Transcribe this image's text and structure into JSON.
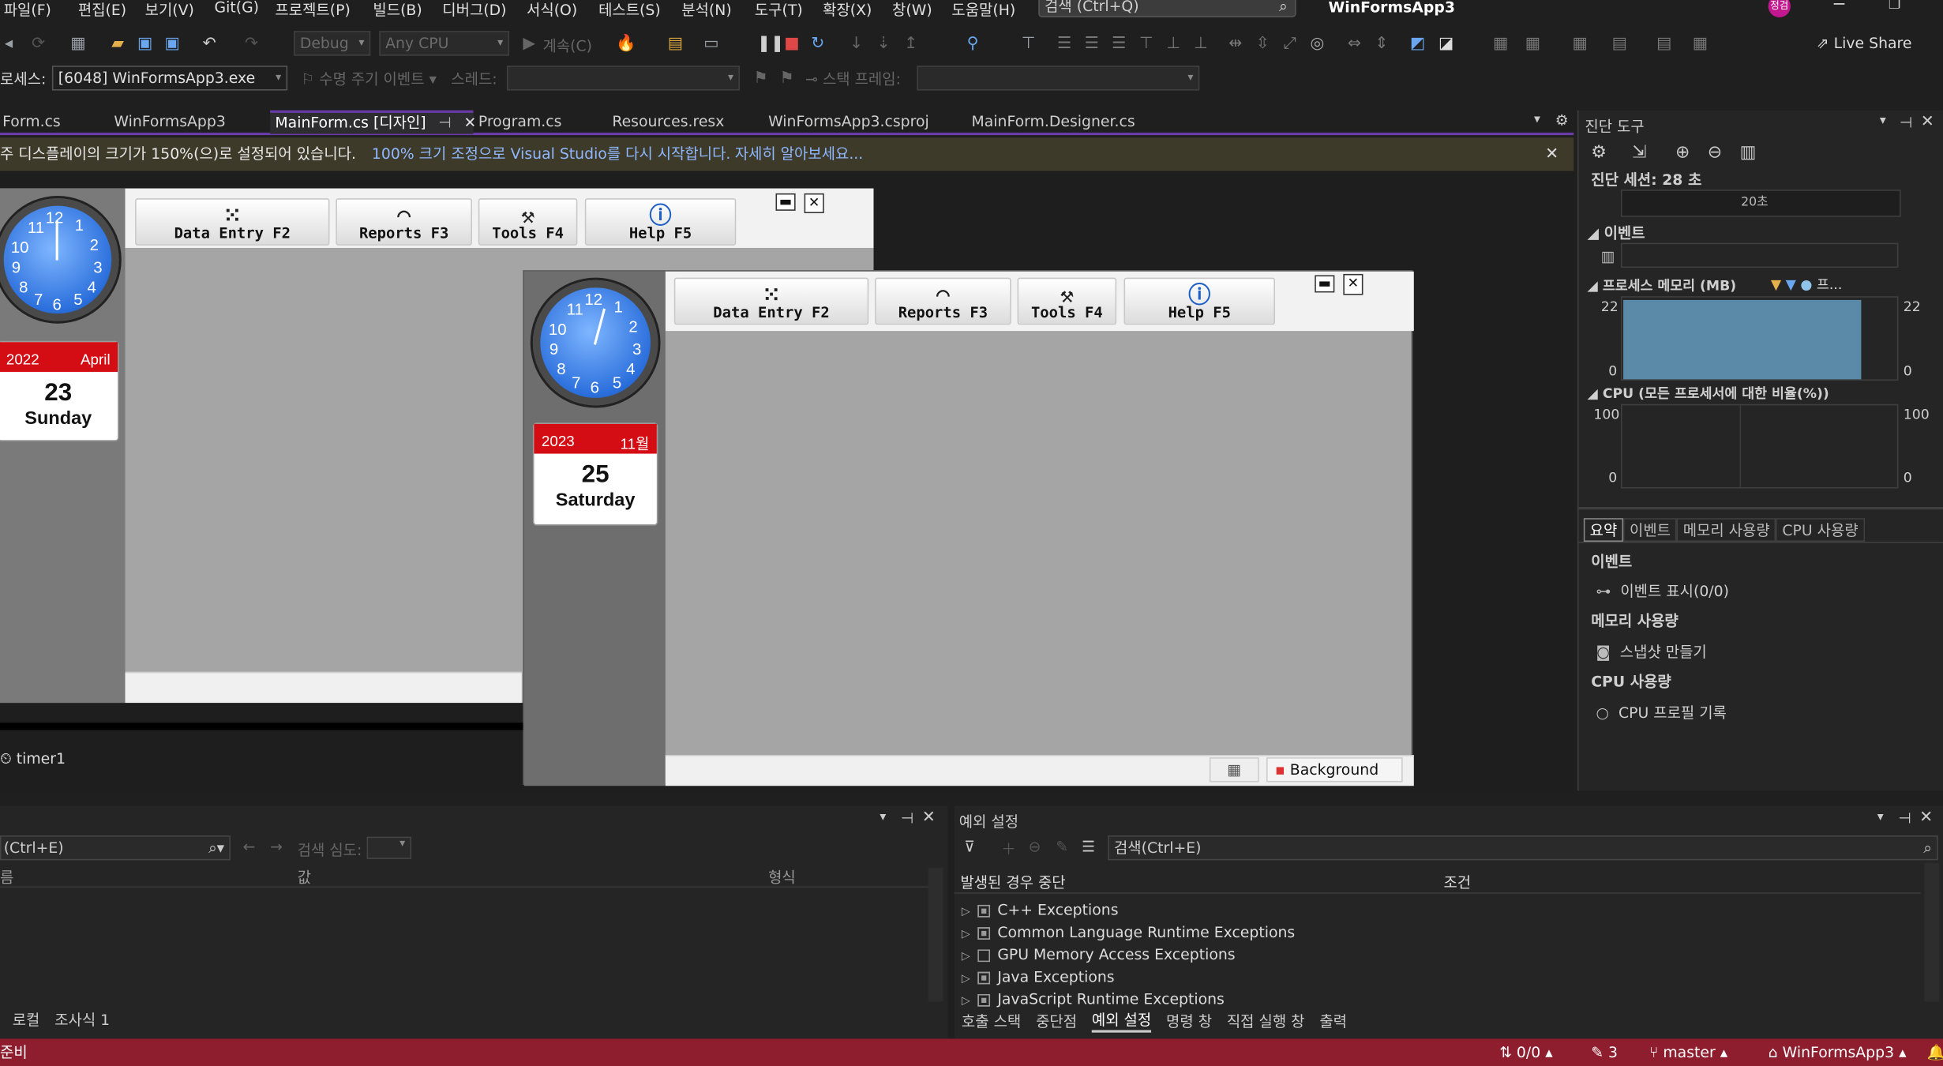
{
  "menu": [
    "파일(F)",
    "편집(E)",
    "보기(V)",
    "Git(G)",
    "프로젝트(P)",
    "빌드(B)",
    "디버그(D)",
    "서식(O)",
    "테스트(S)",
    "분석(N)",
    "도구(T)",
    "확장(X)",
    "창(W)",
    "도움말(H)"
  ],
  "search_placeholder": "검색 (Ctrl+Q)",
  "app_title": "WinFormsApp3",
  "user_badge": "정검",
  "toolbar": {
    "config": "Debug",
    "platform": "Any CPU",
    "continue_label": "계속(C)",
    "live_share": "Live Share",
    "process_label": "로세스:",
    "process_value": "[6048] WinFormsApp3.exe",
    "lifecycle_label": "수명 주기 이벤트",
    "thread_label": "스레드:",
    "stackframe_label": "스택 프레임:"
  },
  "tabs": [
    "Form.cs",
    "WinFormsApp3",
    "MainForm.cs [디자인]",
    "Program.cs",
    "Resources.resx",
    "WinFormsApp3.csproj",
    "MainForm.Designer.cs"
  ],
  "infobar": {
    "message": "주 디스플레이의 크기가 150%(으)로 설정되어 있습니다.",
    "link1": "100% 크기 조정으로 Visual Studio를 다시 시작합니다.",
    "link2": "자세히 알아보세요..."
  },
  "form_buttons": [
    "Data Entry F2",
    "Reports F3",
    "Tools F4",
    "Help F5"
  ],
  "calendar_back": {
    "year": "2022",
    "month": "April",
    "day": "23",
    "weekday": "Sunday"
  },
  "calendar_front": {
    "year": "2023",
    "month": "11월",
    "day": "25",
    "weekday": "Saturday"
  },
  "clock_numbers": [
    "12",
    "1",
    "2",
    "3",
    "4",
    "5",
    "6",
    "7",
    "8",
    "9",
    "10",
    "11"
  ],
  "background_button": "Background",
  "timer_label": "timer1",
  "diagnostics": {
    "title": "진단 도구",
    "session": "진단 세션: 28 초",
    "timeline_tick": "20초",
    "events_header": "이벤트",
    "memory_header": "프로세스 메모리 (MB)",
    "memory_legend": "프...",
    "mem_max": "22",
    "mem_min": "0",
    "cpu_header": "CPU (모든 프로세서에 대한 비율(%))",
    "cpu_max": "100",
    "cpu_min": "0",
    "subtabs": [
      "요약",
      "이벤트",
      "메모리 사용량",
      "CPU 사용량"
    ],
    "events_section": "이벤트",
    "events_item": "이벤트 표시(0/0)",
    "memory_section": "메모리 사용량",
    "memory_item": "스냅샷 만들기",
    "cpu_section": "CPU 사용량",
    "cpu_item": "CPU 프로필 기록"
  },
  "locals": {
    "search": "(Ctrl+E)",
    "depth_label": "검색 심도:",
    "col_name": "름",
    "col_value": "값",
    "col_type": "형식",
    "tabs": [
      "로컬",
      "조사식 1"
    ]
  },
  "exceptions": {
    "title": "예외 설정",
    "search": "검색(Ctrl+E)",
    "col1": "발생된 경우 중단",
    "col2": "조건",
    "items": [
      {
        "label": "C++ Exceptions",
        "checked": true
      },
      {
        "label": "Common Language Runtime Exceptions",
        "checked": true
      },
      {
        "label": "GPU Memory Access Exceptions",
        "checked": false
      },
      {
        "label": "Java Exceptions",
        "checked": true
      },
      {
        "label": "JavaScript Runtime Exceptions",
        "checked": true
      }
    ],
    "tabs": [
      "호출 스택",
      "중단점",
      "예외 설정",
      "명령 창",
      "직접 실행 창",
      "출력"
    ]
  },
  "status": {
    "left": "준비",
    "sync": "0/0",
    "edits": "3",
    "branch": "master",
    "repo": "WinFormsApp3"
  },
  "colors": {
    "accent": "#6a3aa8",
    "statusbar": "#8e1d2e",
    "calendar_red": "#d40d14"
  }
}
